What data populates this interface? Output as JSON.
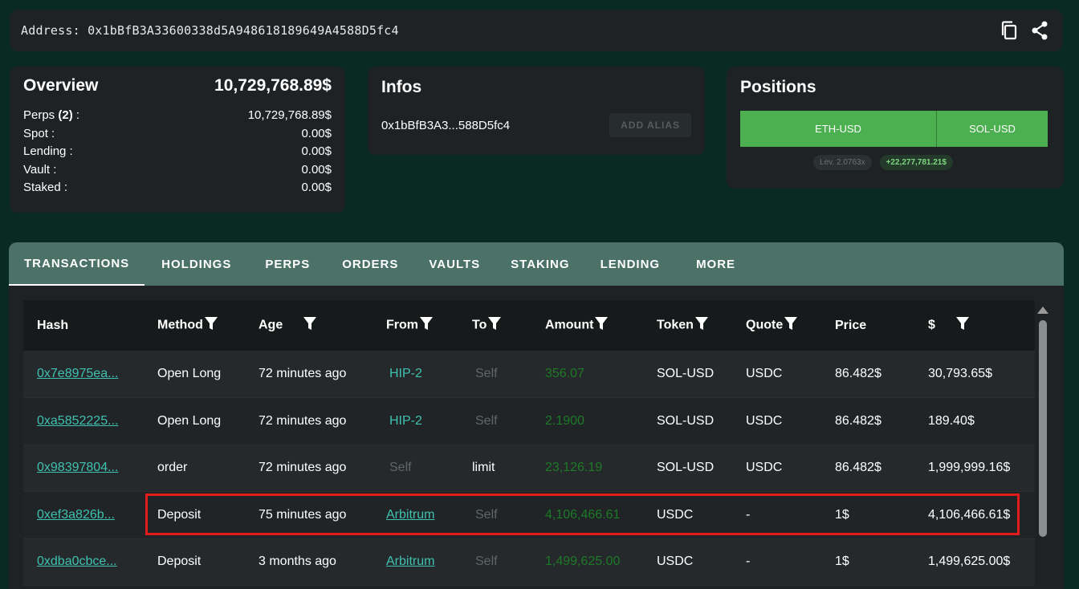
{
  "address": {
    "label": "Address: 0x1bBfB3A33600338d5A948618189649A4588D5fc4"
  },
  "overview": {
    "title": "Overview",
    "total": "10,729,768.89$",
    "rows": [
      {
        "label": "Perps",
        "count": "(2)",
        "suffix": " :",
        "value": "10,729,768.89$"
      },
      {
        "label": "Spot :",
        "value": "0.00$"
      },
      {
        "label": "Lending :",
        "value": "0.00$"
      },
      {
        "label": "Vault :",
        "value": "0.00$"
      },
      {
        "label": "Staked :",
        "value": "0.00$"
      }
    ]
  },
  "infos": {
    "title": "Infos",
    "short_address": "0x1bBfB3A3...588D5fc4",
    "alias_button": "ADD ALIAS"
  },
  "positions": {
    "title": "Positions",
    "segments": [
      {
        "label": "ETH-USD"
      },
      {
        "label": "SOL-USD"
      }
    ],
    "leverage": "Lev. 2.0763x",
    "pnl": "+22,277,781.21$"
  },
  "tabs": [
    "TRANSACTIONS",
    "HOLDINGS",
    "PERPS",
    "ORDERS",
    "VAULTS",
    "STAKING",
    "LENDING",
    "MORE"
  ],
  "table": {
    "headers": [
      "Hash",
      "Method",
      "Age",
      "From",
      "To",
      "Amount",
      "Token",
      "Quote",
      "Price",
      "$"
    ],
    "rows": [
      {
        "hash": "0x7e8975ea...",
        "method": "Open Long",
        "age": "72 minutes ago",
        "from": "HIP-2",
        "to": "Self",
        "amount": "356.07",
        "token": "SOL-USD",
        "quote": "USDC",
        "price": "86.482$",
        "usd": "30,793.65$"
      },
      {
        "hash": "0xa5852225...",
        "method": "Open Long",
        "age": "72 minutes ago",
        "from": "HIP-2",
        "to": "Self",
        "amount": "2.1900",
        "token": "SOL-USD",
        "quote": "USDC",
        "price": "86.482$",
        "usd": "189.40$"
      },
      {
        "hash": "0x98397804...",
        "method": "order",
        "age": "72 minutes ago",
        "from": "Self",
        "to": "limit",
        "amount": "23,126.19",
        "token": "SOL-USD",
        "quote": "USDC",
        "price": "86.482$",
        "usd": "1,999,999.16$"
      },
      {
        "hash": "0xef3a826b...",
        "method": "Deposit",
        "age": "75 minutes ago",
        "from": "Arbitrum",
        "to": "Self",
        "amount": "4,106,466.61",
        "token": "USDC",
        "quote": "-",
        "price": "1$",
        "usd": "4,106,466.61$"
      },
      {
        "hash": "0xdba0cbce...",
        "method": "Deposit",
        "age": "3 months ago",
        "from": "Arbitrum",
        "to": "Self",
        "amount": "1,499,625.00",
        "token": "USDC",
        "quote": "-",
        "price": "1$",
        "usd": "1,499,625.00$"
      }
    ]
  },
  "colors": {
    "background": "#082a23",
    "card": "#1f2224",
    "tab_bar": "#4c7268",
    "accent_green": "#4caf50",
    "link": "#3fc1b0",
    "highlight": "#e41b1b"
  }
}
